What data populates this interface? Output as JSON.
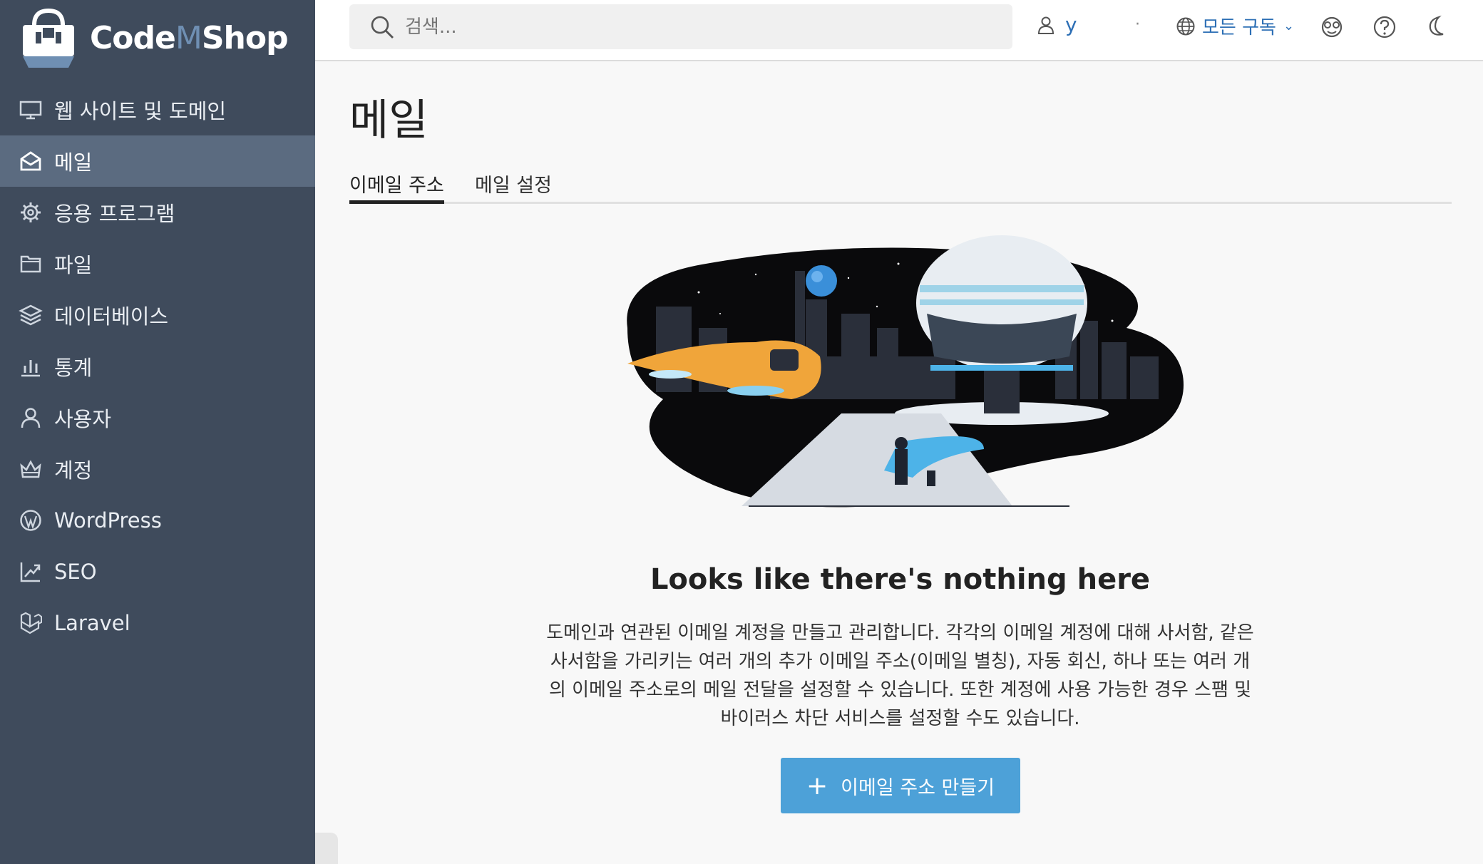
{
  "brand": {
    "part1": "Code",
    "part2": "M",
    "part3": "Shop"
  },
  "sidebar": {
    "items": [
      {
        "label": "웹 사이트 및 도메인",
        "icon": "monitor-icon"
      },
      {
        "label": "메일",
        "icon": "mail-icon"
      },
      {
        "label": "응용 프로그램",
        "icon": "gear-icon"
      },
      {
        "label": "파일",
        "icon": "folder-icon"
      },
      {
        "label": "데이터베이스",
        "icon": "layers-icon"
      },
      {
        "label": "통계",
        "icon": "bar-chart-icon"
      },
      {
        "label": "사용자",
        "icon": "user-icon"
      },
      {
        "label": "계정",
        "icon": "crown-icon"
      },
      {
        "label": "WordPress",
        "icon": "wordpress-icon"
      },
      {
        "label": "SEO",
        "icon": "seo-icon"
      },
      {
        "label": "Laravel",
        "icon": "laravel-icon"
      }
    ],
    "active_index": 1
  },
  "topbar": {
    "search_placeholder": "검색...",
    "user_name": "y",
    "separator": "·",
    "subscription_label": "모든 구독",
    "icons": [
      "shield-icon",
      "help-icon",
      "moon-icon"
    ]
  },
  "main": {
    "title": "메일",
    "tabs": [
      {
        "label": "이메일 주소",
        "active": true
      },
      {
        "label": "메일 설정",
        "active": false
      }
    ],
    "empty_title": "Looks like there's nothing here",
    "empty_description": "도메인과 연관된 이메일 계정을 만들고 관리합니다. 각각의 이메일 계정에 대해 사서함, 같은 사서함을 가리키는 여러 개의 추가 이메일 주소(이메일 별칭), 자동 회신, 하나 또는 여러 개의 이메일 주소로의 메일 전달을 설정할 수 있습니다. 또한 계정에 사용 가능한 경우 스팸 및 바이러스 차단 서비스를 설정할 수도 있습니다.",
    "create_button": "이메일 주소 만들기"
  },
  "colors": {
    "sidebar_bg": "#3f4b5c",
    "sidebar_active": "#5b6b80",
    "accent": "#2d6fb5",
    "button": "#4da1d8"
  }
}
